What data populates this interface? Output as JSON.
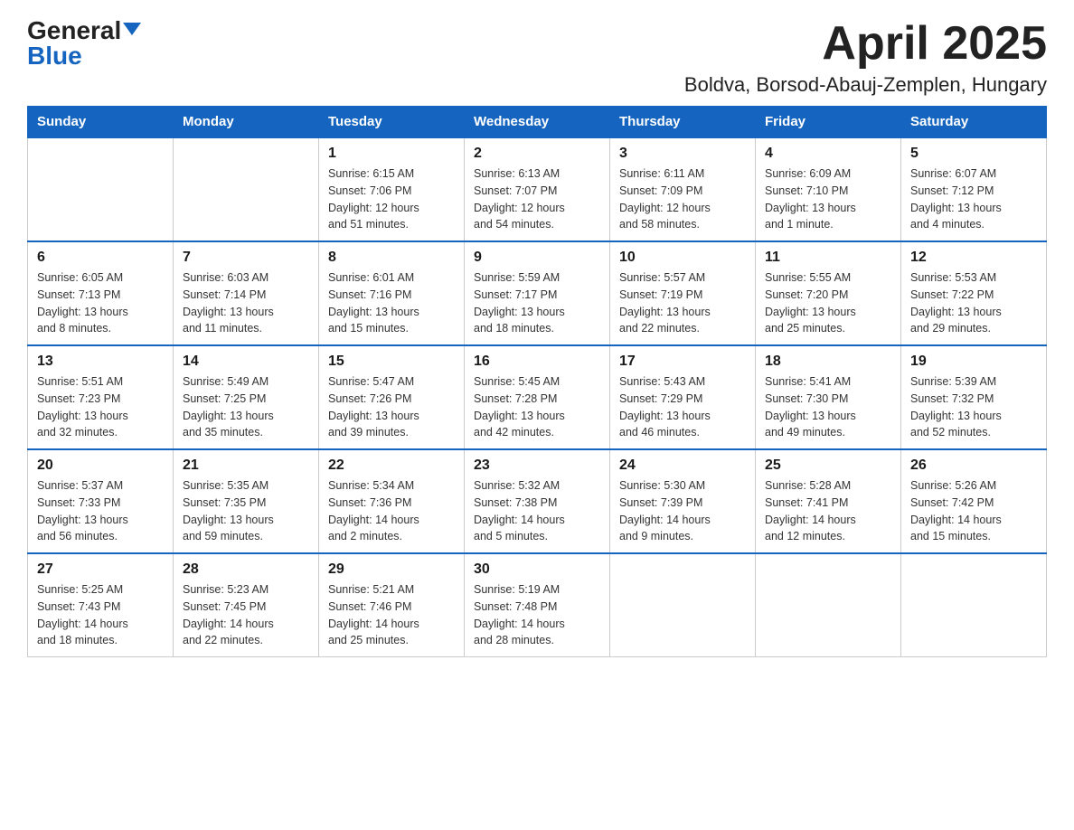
{
  "header": {
    "logo_general": "General",
    "logo_blue": "Blue",
    "month_title": "April 2025",
    "location": "Boldva, Borsod-Abauj-Zemplen, Hungary"
  },
  "weekdays": [
    "Sunday",
    "Monday",
    "Tuesday",
    "Wednesday",
    "Thursday",
    "Friday",
    "Saturday"
  ],
  "weeks": [
    [
      {
        "day": "",
        "info": ""
      },
      {
        "day": "",
        "info": ""
      },
      {
        "day": "1",
        "info": "Sunrise: 6:15 AM\nSunset: 7:06 PM\nDaylight: 12 hours\nand 51 minutes."
      },
      {
        "day": "2",
        "info": "Sunrise: 6:13 AM\nSunset: 7:07 PM\nDaylight: 12 hours\nand 54 minutes."
      },
      {
        "day": "3",
        "info": "Sunrise: 6:11 AM\nSunset: 7:09 PM\nDaylight: 12 hours\nand 58 minutes."
      },
      {
        "day": "4",
        "info": "Sunrise: 6:09 AM\nSunset: 7:10 PM\nDaylight: 13 hours\nand 1 minute."
      },
      {
        "day": "5",
        "info": "Sunrise: 6:07 AM\nSunset: 7:12 PM\nDaylight: 13 hours\nand 4 minutes."
      }
    ],
    [
      {
        "day": "6",
        "info": "Sunrise: 6:05 AM\nSunset: 7:13 PM\nDaylight: 13 hours\nand 8 minutes."
      },
      {
        "day": "7",
        "info": "Sunrise: 6:03 AM\nSunset: 7:14 PM\nDaylight: 13 hours\nand 11 minutes."
      },
      {
        "day": "8",
        "info": "Sunrise: 6:01 AM\nSunset: 7:16 PM\nDaylight: 13 hours\nand 15 minutes."
      },
      {
        "day": "9",
        "info": "Sunrise: 5:59 AM\nSunset: 7:17 PM\nDaylight: 13 hours\nand 18 minutes."
      },
      {
        "day": "10",
        "info": "Sunrise: 5:57 AM\nSunset: 7:19 PM\nDaylight: 13 hours\nand 22 minutes."
      },
      {
        "day": "11",
        "info": "Sunrise: 5:55 AM\nSunset: 7:20 PM\nDaylight: 13 hours\nand 25 minutes."
      },
      {
        "day": "12",
        "info": "Sunrise: 5:53 AM\nSunset: 7:22 PM\nDaylight: 13 hours\nand 29 minutes."
      }
    ],
    [
      {
        "day": "13",
        "info": "Sunrise: 5:51 AM\nSunset: 7:23 PM\nDaylight: 13 hours\nand 32 minutes."
      },
      {
        "day": "14",
        "info": "Sunrise: 5:49 AM\nSunset: 7:25 PM\nDaylight: 13 hours\nand 35 minutes."
      },
      {
        "day": "15",
        "info": "Sunrise: 5:47 AM\nSunset: 7:26 PM\nDaylight: 13 hours\nand 39 minutes."
      },
      {
        "day": "16",
        "info": "Sunrise: 5:45 AM\nSunset: 7:28 PM\nDaylight: 13 hours\nand 42 minutes."
      },
      {
        "day": "17",
        "info": "Sunrise: 5:43 AM\nSunset: 7:29 PM\nDaylight: 13 hours\nand 46 minutes."
      },
      {
        "day": "18",
        "info": "Sunrise: 5:41 AM\nSunset: 7:30 PM\nDaylight: 13 hours\nand 49 minutes."
      },
      {
        "day": "19",
        "info": "Sunrise: 5:39 AM\nSunset: 7:32 PM\nDaylight: 13 hours\nand 52 minutes."
      }
    ],
    [
      {
        "day": "20",
        "info": "Sunrise: 5:37 AM\nSunset: 7:33 PM\nDaylight: 13 hours\nand 56 minutes."
      },
      {
        "day": "21",
        "info": "Sunrise: 5:35 AM\nSunset: 7:35 PM\nDaylight: 13 hours\nand 59 minutes."
      },
      {
        "day": "22",
        "info": "Sunrise: 5:34 AM\nSunset: 7:36 PM\nDaylight: 14 hours\nand 2 minutes."
      },
      {
        "day": "23",
        "info": "Sunrise: 5:32 AM\nSunset: 7:38 PM\nDaylight: 14 hours\nand 5 minutes."
      },
      {
        "day": "24",
        "info": "Sunrise: 5:30 AM\nSunset: 7:39 PM\nDaylight: 14 hours\nand 9 minutes."
      },
      {
        "day": "25",
        "info": "Sunrise: 5:28 AM\nSunset: 7:41 PM\nDaylight: 14 hours\nand 12 minutes."
      },
      {
        "day": "26",
        "info": "Sunrise: 5:26 AM\nSunset: 7:42 PM\nDaylight: 14 hours\nand 15 minutes."
      }
    ],
    [
      {
        "day": "27",
        "info": "Sunrise: 5:25 AM\nSunset: 7:43 PM\nDaylight: 14 hours\nand 18 minutes."
      },
      {
        "day": "28",
        "info": "Sunrise: 5:23 AM\nSunset: 7:45 PM\nDaylight: 14 hours\nand 22 minutes."
      },
      {
        "day": "29",
        "info": "Sunrise: 5:21 AM\nSunset: 7:46 PM\nDaylight: 14 hours\nand 25 minutes."
      },
      {
        "day": "30",
        "info": "Sunrise: 5:19 AM\nSunset: 7:48 PM\nDaylight: 14 hours\nand 28 minutes."
      },
      {
        "day": "",
        "info": ""
      },
      {
        "day": "",
        "info": ""
      },
      {
        "day": "",
        "info": ""
      }
    ]
  ]
}
